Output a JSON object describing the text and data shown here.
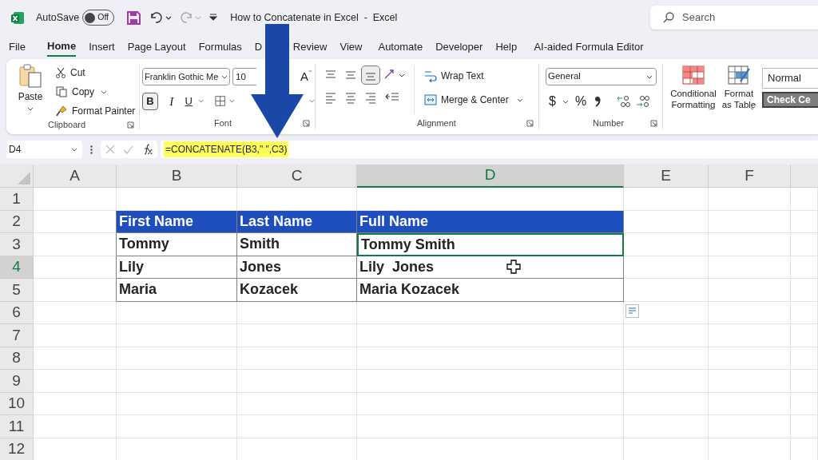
{
  "title_bar": {
    "autosave_label": "AutoSave",
    "autosave": {
      "label": "Off",
      "on": false
    },
    "document_title": "How to Concatenate in Excel",
    "separator": "-",
    "app_name": "Excel",
    "search_placeholder": "Search"
  },
  "tabs": [
    {
      "label": "File",
      "selected": false
    },
    {
      "label": "Home",
      "selected": true
    },
    {
      "label": "Insert",
      "selected": false
    },
    {
      "label": "Page Layout",
      "selected": false
    },
    {
      "label": "Formulas",
      "selected": false
    },
    {
      "label": "D",
      "selected": false
    },
    {
      "label": "Review",
      "selected": false
    },
    {
      "label": "View",
      "selected": false
    },
    {
      "label": "Automate",
      "selected": false
    },
    {
      "label": "Developer",
      "selected": false
    },
    {
      "label": "Help",
      "selected": false
    },
    {
      "label": "AI-aided Formula Editor",
      "selected": false
    }
  ],
  "ribbon": {
    "clipboard": {
      "paste": "Paste",
      "cut": "Cut",
      "copy": "Copy",
      "format_painter": "Format Painter",
      "label": "Clipboard"
    },
    "font": {
      "font_name": "Franklin Gothic Me",
      "font_size": "10",
      "shrink": "A",
      "bold": {
        "label": "B",
        "on": true
      },
      "italic": "I",
      "underline": "U",
      "label": "Font"
    },
    "alignment": {
      "bottom_align": {
        "selected": true
      },
      "wrap_text": "Wrap Text",
      "merge_center": "Merge & Center",
      "label": "Alignment"
    },
    "number": {
      "format": "General",
      "currency": "$",
      "percent": "%",
      "label": "Number"
    },
    "styles": {
      "conditional_formatting": "Conditional Formatting",
      "format_as_table": "Format as Table",
      "normal": "Normal",
      "check_cell": "Check Ce"
    }
  },
  "formula_bar": {
    "name_box": "D4",
    "formula": "=CONCATENATE(B3,\" \",C3)",
    "highlighted": true
  },
  "sheet": {
    "columns": [
      {
        "label": "A",
        "selected": false
      },
      {
        "label": "B",
        "selected": false
      },
      {
        "label": "C",
        "selected": false
      },
      {
        "label": "D",
        "selected": true
      },
      {
        "label": "E",
        "selected": false
      },
      {
        "label": "F",
        "selected": false
      }
    ],
    "rows": [
      {
        "label": "1",
        "selected": false
      },
      {
        "label": "2",
        "selected": false
      },
      {
        "label": "3",
        "selected": false
      },
      {
        "label": "4",
        "selected": true
      },
      {
        "label": "5",
        "selected": false
      },
      {
        "label": "6",
        "selected": false
      },
      {
        "label": "7",
        "selected": false
      },
      {
        "label": "8",
        "selected": false
      },
      {
        "label": "9",
        "selected": false
      },
      {
        "label": "10",
        "selected": false
      },
      {
        "label": "11",
        "selected": false
      },
      {
        "label": "12",
        "selected": false
      }
    ],
    "table": {
      "header": [
        "First Name",
        "Last Name",
        "Full Name"
      ],
      "rows": [
        {
          "cells": [
            "Tommy",
            "Smith",
            "Tommy Smith"
          ],
          "active": true
        },
        {
          "cells": [
            "Lily",
            "Jones",
            "Lily  Jones"
          ],
          "active": false
        },
        {
          "cells": [
            "Maria",
            "Kozacek",
            "Maria Kozacek"
          ],
          "active": false
        }
      ]
    }
  }
}
